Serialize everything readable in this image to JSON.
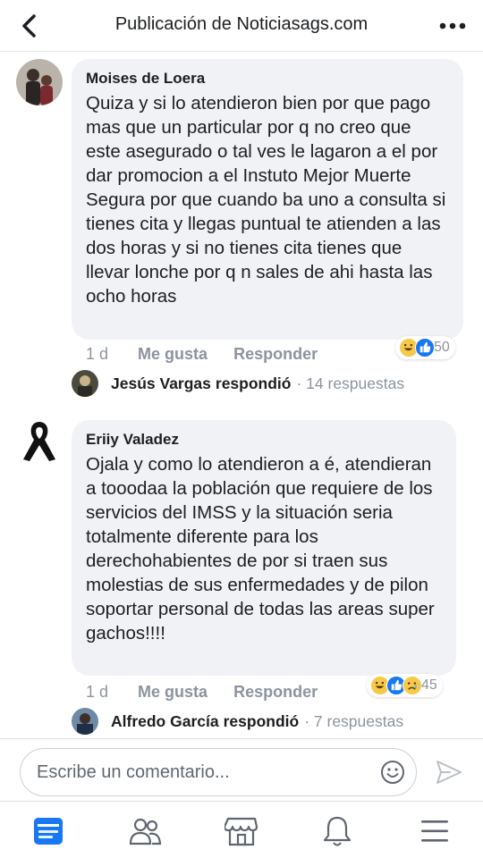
{
  "header": {
    "title": "Publicación de Noticiasags.com"
  },
  "comments": [
    {
      "author": "Moises de Loera",
      "text": "Quiza y si lo atendieron bien por que pago mas que un particular por q no creo que este asegurado o tal ves le lagaron a el por dar promocion a el Instuto Mejor Muerte Segura por que cuando ba uno a consulta si tienes cita y llegas puntual te atienden a las dos horas y si no tienes cita tienes que llevar lonche por q n sales de ahi hasta las ocho horas",
      "time": "1 d",
      "like_label": "Me gusta",
      "reply_label": "Responder",
      "reaction_count": "50",
      "reactions": [
        "haha",
        "like"
      ],
      "reply_author": "Jesús Vargas",
      "reply_verb": "respondió",
      "reply_count": "· 14 respuestas"
    },
    {
      "author": "Eriiy Valadez",
      "text": "Ojala y como lo atendieron a é, atendieran a tooodaa la población que requiere de los servicios del IMSS y la situación seria totalmente diferente para los derechohabientes de por si traen sus molestias de sus enfermedades y de pilon soportar personal de todas las areas super gachos!!!!",
      "time": "1 d",
      "like_label": "Me gusta",
      "reply_label": "Responder",
      "reaction_count": "45",
      "reactions": [
        "haha",
        "like",
        "sad"
      ],
      "reply_author": "Alfredo García",
      "reply_verb": "respondió",
      "reply_count": "· 7 respuestas"
    }
  ],
  "composer": {
    "placeholder": "Escribe un comentario..."
  },
  "colors": {
    "like_blue": "#1877f2",
    "emoji_yellow": "#f7c94b",
    "muted_text": "#8d949e",
    "bubble_bg": "#f0f2f5"
  },
  "bottom_nav": [
    "news-feed-icon",
    "friends-icon",
    "marketplace-icon",
    "notifications-icon",
    "menu-icon"
  ]
}
